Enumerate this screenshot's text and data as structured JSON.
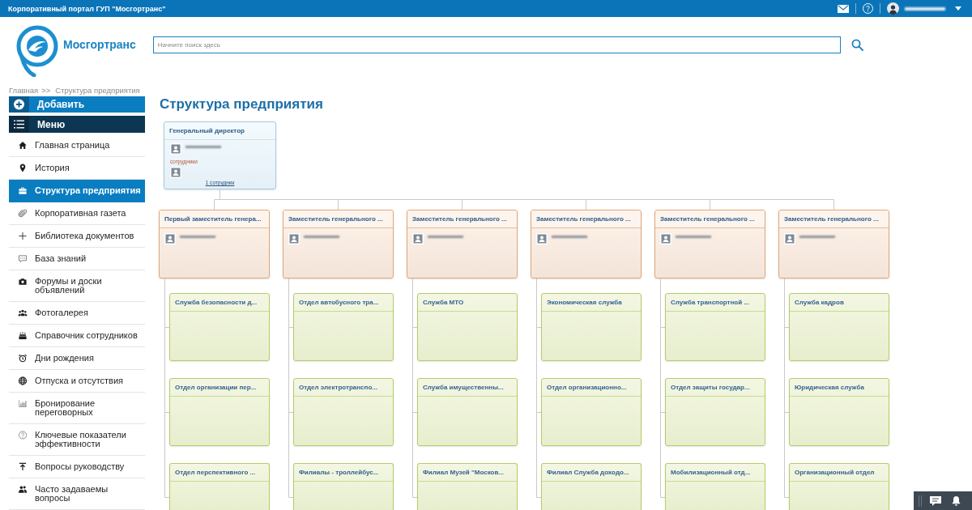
{
  "top_bar": {
    "title": "Корпоративный портал ГУП \"Мосгортранс\""
  },
  "header": {
    "logo_text": "Мосгортранс",
    "search": {
      "placeholder": "Начните поиск здесь"
    }
  },
  "breadcrumb": {
    "items": [
      "Главная",
      "Структура предприятия"
    ],
    "separator": ">>"
  },
  "sidebar": {
    "add_button": "Добавить",
    "menu_button": "Меню",
    "items": [
      {
        "label": "Главная страница",
        "selected": false
      },
      {
        "label": "История",
        "selected": false
      },
      {
        "label": "Структура предприятия",
        "selected": true
      },
      {
        "label": "Корпоративная газета",
        "selected": false
      },
      {
        "label": "Библиотека документов",
        "selected": false
      },
      {
        "label": "База знаний",
        "selected": false
      },
      {
        "label": "Форумы и доски объявлений",
        "selected": false
      },
      {
        "label": "Фотогалерея",
        "selected": false
      },
      {
        "label": "Справочник сотрудников",
        "selected": false
      },
      {
        "label": "Дни рождения",
        "selected": false
      },
      {
        "label": "Отпуска и отсутствия",
        "selected": false
      },
      {
        "label": "Бронирование переговорных",
        "selected": false
      },
      {
        "label": "Ключевые показатели эффективности",
        "selected": false
      },
      {
        "label": "Вопросы руководству",
        "selected": false
      },
      {
        "label": "Часто задаваемы вопросы",
        "selected": false
      }
    ]
  },
  "page": {
    "title": "Структура предприятия"
  },
  "org_chart": {
    "root": {
      "title": "Генеральный директор",
      "staff_label": "сотрудники",
      "staff_link": "1 сотрудник",
      "children": [
        {
          "title": "Первый заместитель генера...",
          "children": [
            {
              "title": "Служба безопасности д..."
            },
            {
              "title": "Отдел организации пер..."
            },
            {
              "title": "Отдел перспективного ..."
            }
          ]
        },
        {
          "title": "Заместитель генерального ...",
          "children": [
            {
              "title": "Отдел автобусного тра..."
            },
            {
              "title": "Отдел электротранспо..."
            },
            {
              "title": "Филиалы - троллейбус..."
            }
          ]
        },
        {
          "title": "Заместитель генерального ...",
          "children": [
            {
              "title": "Служба МТО"
            },
            {
              "title": "Служба имущественны..."
            },
            {
              "title": "Филиал Музей \"Москов..."
            }
          ]
        },
        {
          "title": "Заместитель генерального ...",
          "children": [
            {
              "title": "Экономическая служба"
            },
            {
              "title": "Отдел организационно..."
            },
            {
              "title": "Филиал Служба доходо..."
            }
          ]
        },
        {
          "title": "Заместитель генерального ...",
          "children": [
            {
              "title": "Служба транспортной ..."
            },
            {
              "title": "Отдел защиты государ..."
            },
            {
              "title": "Мобилизационный отд..."
            }
          ]
        },
        {
          "title": "Заместитель генерального ...",
          "children": [
            {
              "title": "Служба кадров"
            },
            {
              "title": "Юридическая служба"
            },
            {
              "title": "Организационный отдел"
            }
          ]
        }
      ]
    }
  }
}
